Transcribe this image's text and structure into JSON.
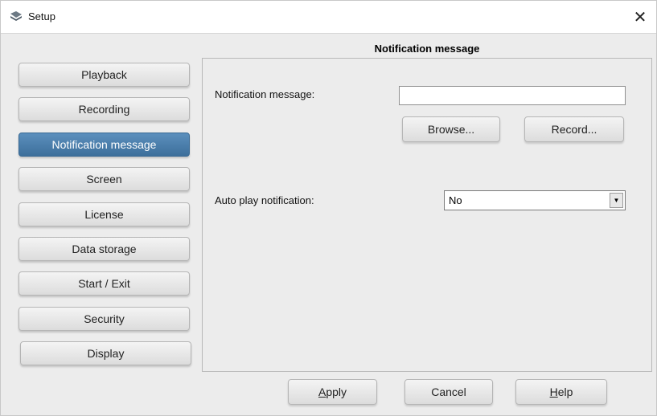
{
  "window": {
    "title": "Setup",
    "app_icon": "setup-app-icon",
    "close_icon": "close-icon",
    "close_glyph": "✕"
  },
  "section_title": "Notification message",
  "nav": {
    "items": [
      {
        "label": "Playback",
        "active": false
      },
      {
        "label": "Recording",
        "active": false
      },
      {
        "label": "Notification message",
        "active": true
      },
      {
        "label": "Screen",
        "active": false
      },
      {
        "label": "License",
        "active": false
      },
      {
        "label": "Data storage",
        "active": false
      },
      {
        "label": "Start / Exit",
        "active": false
      },
      {
        "label": "Security",
        "active": false
      },
      {
        "label": "Display",
        "active": false
      }
    ]
  },
  "form": {
    "notification_label": "Notification message:",
    "notification_value": "",
    "browse_label": "Browse...",
    "record_label": "Record...",
    "autoplay_label": "Auto play notification:",
    "autoplay_value": "No",
    "autoplay_arrow_icon": "dropdown-arrow-icon"
  },
  "buttons": {
    "apply": {
      "mnemonic": "A",
      "rest": "pply"
    },
    "cancel": "Cancel",
    "help": {
      "mnemonic": "H",
      "rest": "elp"
    }
  },
  "colors": {
    "active_nav": "#4a7ca8",
    "window_bg": "#ececec"
  }
}
